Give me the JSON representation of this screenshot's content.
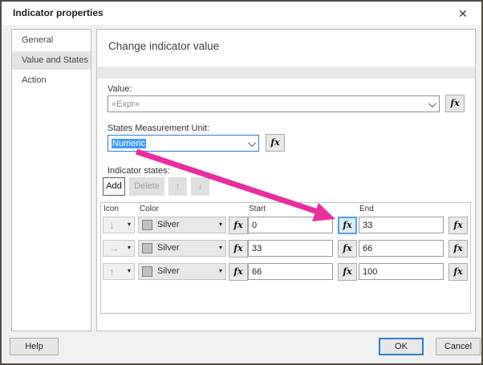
{
  "window": {
    "title": "Indicator properties",
    "close_icon": "✕"
  },
  "sidebar": {
    "items": [
      {
        "label": "General",
        "selected": false
      },
      {
        "label": "Value and States",
        "selected": true
      },
      {
        "label": "Action",
        "selected": false
      }
    ]
  },
  "main": {
    "heading": "Change indicator value",
    "value_section": {
      "label": "Value:",
      "value": "«Expr»",
      "fx_label": "fx"
    },
    "smu_section": {
      "label": "States Measurement Unit:",
      "value": "Numeric",
      "fx_label": "fx"
    },
    "states_section": {
      "label": "Indicator states:",
      "toolbar": {
        "add": "Add",
        "delete": "Delete",
        "up_icon": "↑",
        "down_icon": "↓"
      },
      "table": {
        "headers": {
          "icon": "Icon",
          "color": "Color",
          "start": "Start",
          "end": "End"
        },
        "rows": [
          {
            "icon": "↓",
            "color": "Silver",
            "start": "0",
            "end": "33"
          },
          {
            "icon": "→",
            "color": "Silver",
            "start": "33",
            "end": "66"
          },
          {
            "icon": "↑",
            "color": "Silver",
            "start": "66",
            "end": "100"
          }
        ],
        "highlighted_fx": "row-0-start-fx"
      }
    }
  },
  "footer": {
    "help": "Help",
    "ok": "OK",
    "cancel": "Cancel"
  },
  "icons": {
    "fx": "fx",
    "caret": "▾"
  },
  "colors": {
    "accent_blue": "#2d7dd2",
    "selection_blue": "#3f9bfd",
    "annotation_pink": "#e8309c",
    "silver_swatch": "#c0c0c0"
  }
}
